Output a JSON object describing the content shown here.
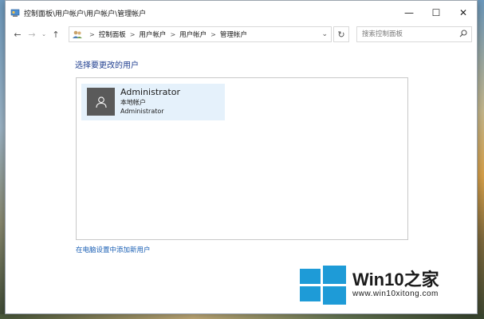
{
  "window": {
    "title": "控制面板\\用户帐户\\用户帐户\\管理帐户",
    "controls": {
      "minimize": "—",
      "maximize": "☐",
      "close": "✕"
    }
  },
  "nav": {
    "back": "←",
    "forward": "→",
    "recent": "⌄",
    "up": "↑",
    "breadcrumbs": [
      "控制面板",
      "用户帐户",
      "用户帐户",
      "管理帐户"
    ],
    "breadcrumb_separator": ">",
    "address_dropdown": "⌄",
    "refresh": "↻"
  },
  "search": {
    "placeholder": "搜索控制面板"
  },
  "main": {
    "heading": "选择要更改的用户",
    "users": [
      {
        "name": "Administrator",
        "type": "本地帐户",
        "subtitle": "Administrator"
      }
    ],
    "add_user_link": "在电脑设置中添加新用户"
  },
  "watermark": {
    "brand_prefix": "Win10",
    "brand_suffix": "之家",
    "url": "www.win10xitong.com",
    "logo_color": "#1e9bd7"
  },
  "colors": {
    "link": "#1a5fb4",
    "heading": "#1e3d8f",
    "tile_bg": "#e5f1fb",
    "avatar_bg": "#5a5a5a"
  }
}
